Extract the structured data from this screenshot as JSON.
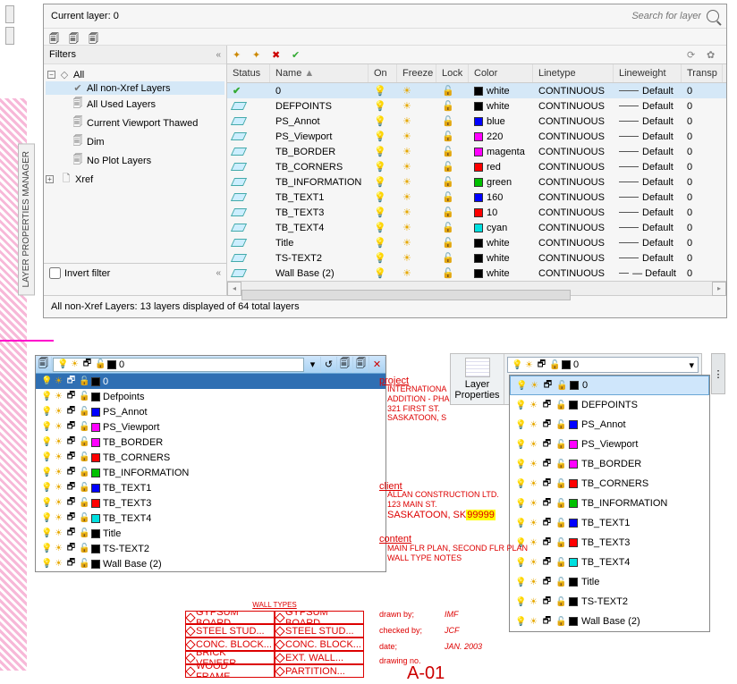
{
  "sideTab": "LAYER PROPERTIES MANAGER",
  "palette": {
    "title": "Current layer: 0",
    "searchPlaceholder": "Search for layer",
    "filtersHeader": "Filters",
    "tree": {
      "root": "All",
      "items": [
        "All non-Xref Layers",
        "All Used Layers",
        "Current Viewport Thawed",
        "Dim",
        "No Plot Layers",
        "Xref"
      ]
    },
    "invertFilter": "Invert filter",
    "columns": {
      "status": "Status",
      "name": "Name",
      "on": "On",
      "freeze": "Freeze",
      "lock": "Lock",
      "color": "Color",
      "linetype": "Linetype",
      "lineweight": "Lineweight",
      "transp": "Transp"
    },
    "rows": [
      {
        "name": "0",
        "color": "white",
        "hex": "#000",
        "linetype": "CONTINUOUS",
        "lw": "Default",
        "tr": "0",
        "sel": true,
        "status": "check"
      },
      {
        "name": "DEFPOINTS",
        "color": "white",
        "hex": "#000",
        "linetype": "CONTINUOUS",
        "lw": "Default",
        "tr": "0"
      },
      {
        "name": "PS_Annot",
        "color": "blue",
        "hex": "#0000ff",
        "linetype": "CONTINUOUS",
        "lw": "Default",
        "tr": "0"
      },
      {
        "name": "PS_Viewport",
        "color": "220",
        "hex": "#ff00ff",
        "linetype": "CONTINUOUS",
        "lw": "Default",
        "tr": "0"
      },
      {
        "name": "TB_BORDER",
        "color": "magenta",
        "hex": "#ff00ff",
        "linetype": "CONTINUOUS",
        "lw": "Default",
        "tr": "0"
      },
      {
        "name": "TB_CORNERS",
        "color": "red",
        "hex": "#ff0000",
        "linetype": "CONTINUOUS",
        "lw": "Default",
        "tr": "0"
      },
      {
        "name": "TB_INFORMATION",
        "color": "green",
        "hex": "#00c000",
        "linetype": "CONTINUOUS",
        "lw": "Default",
        "tr": "0"
      },
      {
        "name": "TB_TEXT1",
        "color": "160",
        "hex": "#0000ff",
        "linetype": "CONTINUOUS",
        "lw": "Default",
        "tr": "0"
      },
      {
        "name": "TB_TEXT3",
        "color": "10",
        "hex": "#ff0000",
        "linetype": "CONTINUOUS",
        "lw": "Default",
        "tr": "0"
      },
      {
        "name": "TB_TEXT4",
        "color": "cyan",
        "hex": "#00e0e0",
        "linetype": "CONTINUOUS",
        "lw": "Default",
        "tr": "0"
      },
      {
        "name": "Title",
        "color": "white",
        "hex": "#000",
        "linetype": "CONTINUOUS",
        "lw": "Default",
        "tr": "0"
      },
      {
        "name": "TS-TEXT2",
        "color": "white",
        "hex": "#000",
        "linetype": "CONTINUOUS",
        "lw": "Default",
        "tr": "0"
      },
      {
        "name": "Wall Base (2)",
        "color": "white",
        "hex": "#000",
        "linetype": "CONTINUOUS",
        "lw": "— Default",
        "tr": "0"
      }
    ],
    "status": "All non-Xref Layers: 13 layers displayed of 64 total layers"
  },
  "comboA": {
    "selected": "0",
    "items": [
      {
        "name": "0",
        "hex": "#000",
        "hl": true
      },
      {
        "name": "Defpoints",
        "hex": "#000"
      },
      {
        "name": "PS_Annot",
        "hex": "#0000ff"
      },
      {
        "name": "PS_Viewport",
        "hex": "#ff00ff"
      },
      {
        "name": "TB_BORDER",
        "hex": "#ff00ff"
      },
      {
        "name": "TB_CORNERS",
        "hex": "#ff0000"
      },
      {
        "name": "TB_INFORMATION",
        "hex": "#00c000"
      },
      {
        "name": "TB_TEXT1",
        "hex": "#0000ff"
      },
      {
        "name": "TB_TEXT3",
        "hex": "#ff0000"
      },
      {
        "name": "TB_TEXT4",
        "hex": "#00e0e0"
      },
      {
        "name": "Title",
        "hex": "#000"
      },
      {
        "name": "TS-TEXT2",
        "hex": "#000"
      },
      {
        "name": "Wall Base (2)",
        "hex": "#000"
      }
    ]
  },
  "ribbon": {
    "label": "Layer\nProperties",
    "selected": "0"
  },
  "comboB": {
    "items": [
      {
        "name": "0",
        "hex": "#000",
        "hl": true
      },
      {
        "name": "DEFPOINTS",
        "hex": "#000"
      },
      {
        "name": "PS_Annot",
        "hex": "#0000ff"
      },
      {
        "name": "PS_Viewport",
        "hex": "#ff00ff"
      },
      {
        "name": "TB_BORDER",
        "hex": "#ff00ff"
      },
      {
        "name": "TB_CORNERS",
        "hex": "#ff0000"
      },
      {
        "name": "TB_INFORMATION",
        "hex": "#00c000"
      },
      {
        "name": "TB_TEXT1",
        "hex": "#0000ff"
      },
      {
        "name": "TB_TEXT3",
        "hex": "#ff0000"
      },
      {
        "name": "TB_TEXT4",
        "hex": "#00e0e0"
      },
      {
        "name": "Title",
        "hex": "#000"
      },
      {
        "name": "TS-TEXT2",
        "hex": "#000"
      },
      {
        "name": "Wall Base (2)",
        "hex": "#000"
      }
    ]
  },
  "anno": {
    "projectLabel": "project",
    "project": "INTERNATIONA\nADDITION - PHA\n321 FIRST ST.\nSASKATOON, S",
    "clientLabel": "client",
    "client1": "ALLAN CONSTRUCTION LTD.",
    "client2": "123 MAIN ST.",
    "client3": "SASKATOON, SK",
    "clientHl": "99999",
    "contentLabel": "content",
    "content": "MAIN FLR PLAN, SECOND FLR PLAN\nWALL TYPE NOTES",
    "drawnLbl": "drawn by;",
    "drawnVal": "IMF",
    "checkedLbl": "checked by;",
    "checkedVal": "JCF",
    "dateLbl": "date;",
    "dateVal": "JAN. 2003",
    "drawingNoLbl": "drawing no.",
    "sheet": "A-01",
    "wallTitle": "WALL TYPES"
  }
}
